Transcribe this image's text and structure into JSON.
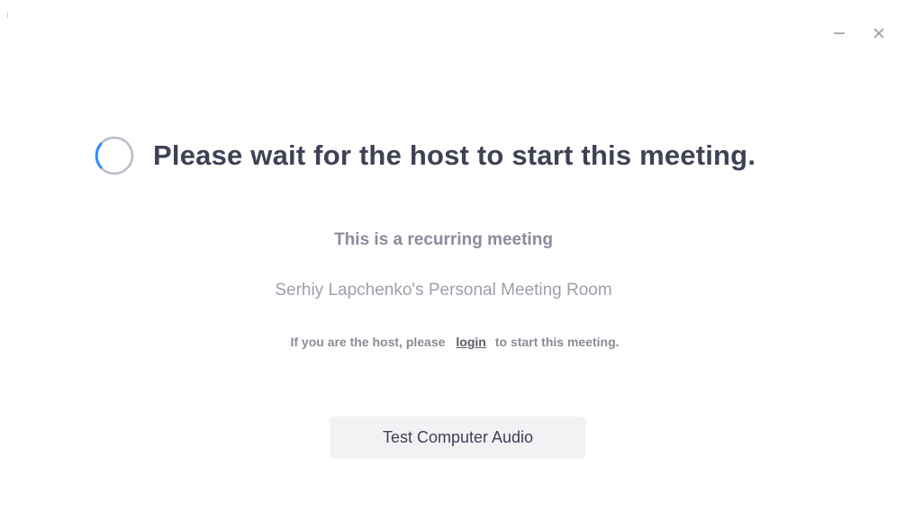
{
  "window": {
    "controls": {
      "minimize_icon": "minimize-icon",
      "close_icon": "close-icon"
    }
  },
  "main": {
    "heading": "Please wait for the host to start this meeting.",
    "recurring_label": "This is a recurring meeting",
    "room_name": "Serhiy Lapchenko's Personal Meeting Room",
    "host_prefix": "If you are the host, please",
    "login_link": "login",
    "host_suffix": "to start this meeting.",
    "test_audio_button": "Test Computer Audio"
  },
  "colors": {
    "heading": "#3f4156",
    "spinner_accent": "#2d8cff",
    "spinner_track": "#b9bcc8",
    "button_bg": "#f2f2f5"
  }
}
